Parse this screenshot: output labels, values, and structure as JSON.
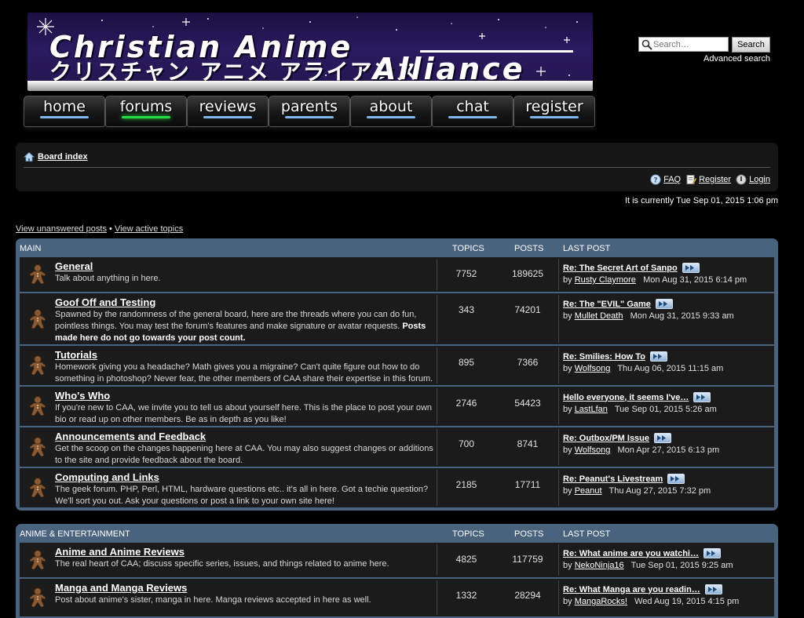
{
  "header": {
    "logo_text_en": "Christian Anime Alliance",
    "logo_text_jp": "クリスチャン アニメ アライアンス",
    "search_placeholder": "Search…",
    "search_button": "Search",
    "advanced_search": "Advanced search"
  },
  "nav": [
    {
      "label": "home",
      "active": false
    },
    {
      "label": "forums",
      "active": true
    },
    {
      "label": "reviews",
      "active": false
    },
    {
      "label": "parents",
      "active": false
    },
    {
      "label": "about",
      "active": false
    },
    {
      "label": "chat",
      "active": false
    },
    {
      "label": "register",
      "active": false
    }
  ],
  "breadcrumb": {
    "label": "Board index"
  },
  "userlinks": {
    "faq": "FAQ",
    "register": "Register",
    "login": "Login"
  },
  "datetime": "It is currently Tue Sep 01, 2015 1:06 pm",
  "quicklinks": {
    "unanswered": "View unanswered posts",
    "separator": "•",
    "active": "View active topics"
  },
  "columns": {
    "topics": "TOPICS",
    "posts": "POSTS",
    "last_post": "LAST POST"
  },
  "categories": [
    {
      "name": "MAIN",
      "forums": [
        {
          "title": "General",
          "desc": "Talk about anything in here.",
          "desc_bold": "",
          "topics": "7752",
          "posts": "189625",
          "last_title": "Re: The Secret Art of Sanpo",
          "by": "by",
          "last_user": "Rusty Claymore",
          "last_date": "Mon Aug 31, 2015 6:14 pm"
        },
        {
          "title": "Goof Off and Testing",
          "desc": "Spawned by the randomness of the general board, here are the threads where you can do fun, pointless things. You may test the forum's features and make signature or avatar requests. ",
          "desc_bold": "Posts made here do not go towards your post count.",
          "topics": "343",
          "posts": "74201",
          "last_title": "Re: The \"EVIL\" Game",
          "by": "by",
          "last_user": "Mullet Death",
          "last_date": "Mon Aug 31, 2015 9:33 am"
        },
        {
          "title": "Tutorials",
          "desc": "Homework giving you a headache? Math gives you a migraine? Can't quite figure out how to do something in photoshop? Never fear, the other members of CAA share their expertise in this forum.",
          "desc_bold": "",
          "topics": "895",
          "posts": "7366",
          "last_title": "Re: Smilies: How To",
          "by": "by",
          "last_user": "Wolfsong",
          "last_date": "Thu Aug 06, 2015 11:15 am"
        },
        {
          "title": "Who's Who",
          "desc": "If you're new to CAA, we invite you to tell us about yourself here. This is the place to post your own bio or read up on other members. Be as in depth as you like!",
          "desc_bold": "",
          "topics": "2746",
          "posts": "54423",
          "last_title": "Hello everyone, it seems I've…",
          "by": "by",
          "last_user": "LastLfan",
          "last_date": "Tue Sep 01, 2015 5:26 am"
        },
        {
          "title": "Announcements and Feedback",
          "desc": "Get the scoop on the changes happening here at CAA. You may also suggest changes or additions to the site and provide feedback about the board.",
          "desc_bold": "",
          "topics": "700",
          "posts": "8741",
          "last_title": "Re: Outbox/PM Issue",
          "by": "by",
          "last_user": "Wolfsong",
          "last_date": "Mon Apr 27, 2015 6:13 pm"
        },
        {
          "title": "Computing and Links",
          "desc": "The geek forum. PHP, Perl, HTML, hardware questions etc.. it's all in here. Got a techie question? We'll sort you out. Ask your questions or post a link to your own site here!",
          "desc_bold": "",
          "topics": "2185",
          "posts": "17711",
          "last_title": "Re: Peanut's Livestream",
          "by": "by",
          "last_user": "Peanut",
          "last_date": "Thu Aug 27, 2015 7:32 pm"
        }
      ]
    },
    {
      "name": "ANIME & ENTERTAINMENT",
      "forums": [
        {
          "title": "Anime and Anime Reviews",
          "desc": "The real heart of CAA; discuss specific series, issues, and things related to anime here.",
          "desc_bold": "",
          "topics": "4825",
          "posts": "117759",
          "last_title": "Re: What anime are you watchi…",
          "by": "by",
          "last_user": "NekoNinja16",
          "last_date": "Tue Sep 01, 2015 9:25 am"
        },
        {
          "title": "Manga and Manga Reviews",
          "desc": "Post about anime's sister, manga in here. Manga reviews accepted in here as well.",
          "desc_bold": "",
          "topics": "1332",
          "posts": "28294",
          "last_title": "Re: What Manga are you readin…",
          "by": "by",
          "last_user": "MangaRocks!",
          "last_date": "Wed Aug 19, 2015 4:15 pm"
        }
      ]
    }
  ]
}
